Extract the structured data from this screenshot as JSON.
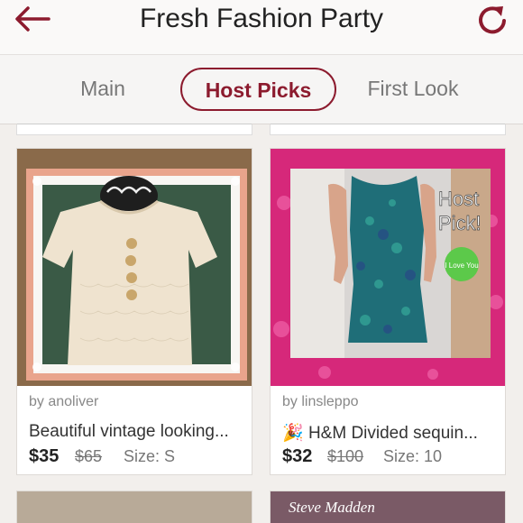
{
  "header": {
    "title": "Fresh Fashion Party",
    "back_icon": "back-arrow-icon",
    "refresh_icon": "refresh-icon",
    "accent_color": "#8c1b2e"
  },
  "tabs": [
    {
      "label": "Main",
      "selected": false
    },
    {
      "label": "Host Picks",
      "selected": true
    },
    {
      "label": "First Look",
      "selected": false
    }
  ],
  "listings": [
    {
      "seller": "by anoliver",
      "title": "Beautiful vintage looking...",
      "price": "$35",
      "original_price": "$65",
      "size": "Size: S"
    },
    {
      "seller": "by linsleppo",
      "title_emoji": "🎉",
      "title": "H&M Divided sequin...",
      "price": "$32",
      "original_price": "$100",
      "size": "Size: 10",
      "overlay_texts": [
        "Host",
        "Pick!",
        "I Love You"
      ]
    }
  ],
  "partial_listing": {
    "banner": "Steve Madden"
  }
}
